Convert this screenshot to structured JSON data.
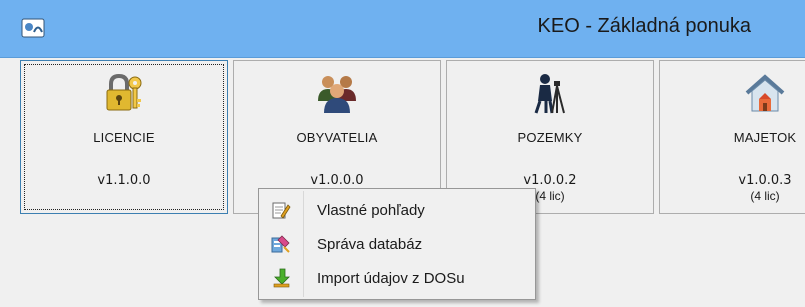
{
  "window": {
    "title": "KEO - Základná ponuka",
    "icon": "app-logo-icon",
    "titlebar_color": "#6fb1f0"
  },
  "tiles": [
    {
      "name": "LICENCIE",
      "version": "v1.1.0.0",
      "licenses": "",
      "icon": "padlock-key-icon",
      "selected": true
    },
    {
      "name": "OBYVATELIA",
      "version": "v1.0.0.0",
      "licenses": "",
      "icon": "people-group-icon",
      "selected": false
    },
    {
      "name": "POZEMKY",
      "version": "v1.0.0.2",
      "licenses": "(4 lic)",
      "icon": "surveyor-tripod-icon",
      "selected": false
    },
    {
      "name": "MAJETOK",
      "version": "v1.0.0.3",
      "licenses": "(4 lic)",
      "icon": "house-icon",
      "selected": false
    }
  ],
  "context_menu": {
    "items": [
      {
        "label": "Vlastné pohľady",
        "icon": "edit-form-icon"
      },
      {
        "label": "Správa databáz",
        "icon": "database-tools-icon"
      },
      {
        "label": "Import údajov z DOSu",
        "icon": "import-arrow-icon"
      }
    ]
  }
}
